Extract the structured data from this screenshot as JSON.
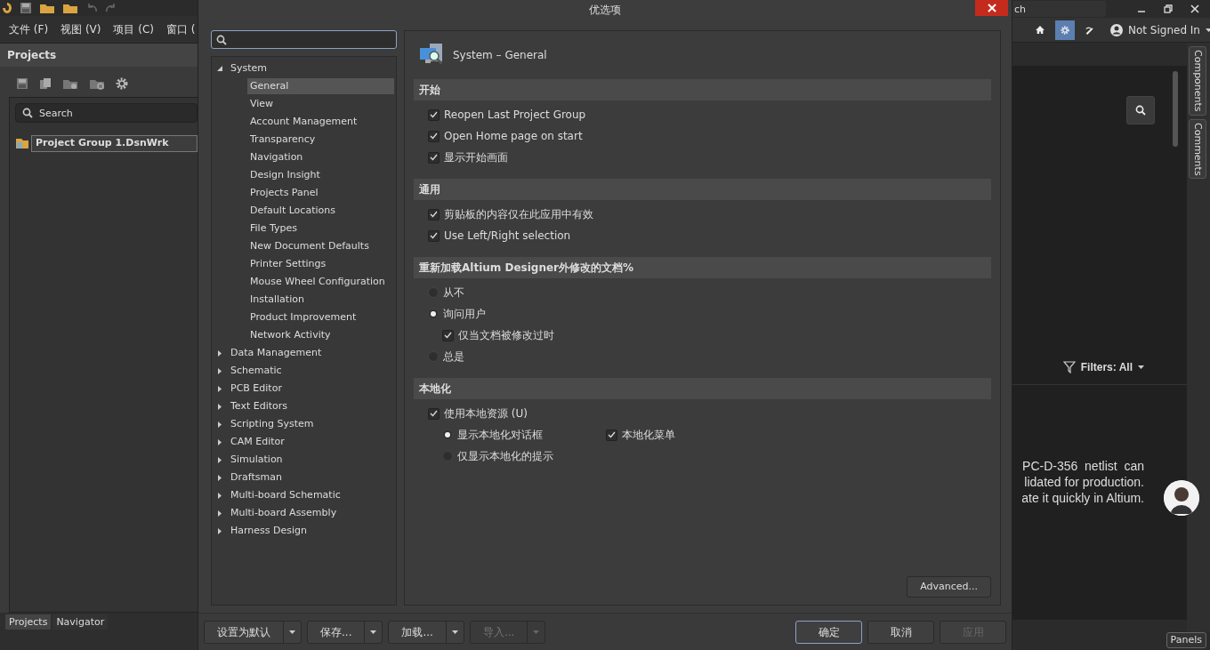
{
  "app": {
    "menu": [
      "文件 (F)",
      "视图 (V)",
      "项目 (C)",
      "窗口 ("
    ],
    "projects_panel": {
      "title": "Projects",
      "search": {
        "placeholder": "Search"
      },
      "items": [
        {
          "label": "Project Group 1.DsnWrk",
          "selected": true
        }
      ],
      "tabs": [
        {
          "label": "Projects",
          "selected": true
        },
        {
          "label": "Navigator",
          "selected": false
        }
      ]
    },
    "search_field": {
      "value": "ch"
    },
    "toolbar": [
      {
        "kind": "home",
        "selected": false
      },
      {
        "kind": "gear",
        "selected": true
      },
      {
        "kind": "pen",
        "selected": false
      }
    ],
    "account": "Not Signed In",
    "side_tabs": [
      "Components",
      "Comments"
    ],
    "filter": "Filters: All",
    "text_lines": [
      "PC-D-356  netlist  can",
      "lidated for production.",
      "ate it quickly in Altium."
    ],
    "panels_button": "Panels"
  },
  "dialog": {
    "title": "优选项",
    "tree": [
      {
        "label": "System",
        "expanded": true,
        "selected": false,
        "children": [
          {
            "label": "General",
            "selected": true
          },
          {
            "label": "View",
            "selected": false
          },
          {
            "label": "Account Management",
            "selected": false
          },
          {
            "label": "Transparency",
            "selected": false
          },
          {
            "label": "Navigation",
            "selected": false
          },
          {
            "label": "Design Insight",
            "selected": false
          },
          {
            "label": "Projects Panel",
            "selected": false
          },
          {
            "label": "Default Locations",
            "selected": false
          },
          {
            "label": "File Types",
            "selected": false
          },
          {
            "label": "New Document Defaults",
            "selected": false
          },
          {
            "label": "Printer Settings",
            "selected": false
          },
          {
            "label": "Mouse Wheel Configuration",
            "selected": false
          },
          {
            "label": "Installation",
            "selected": false
          },
          {
            "label": "Product Improvement",
            "selected": false
          },
          {
            "label": "Network Activity",
            "selected": false
          }
        ]
      },
      {
        "label": "Data Management",
        "expanded": false,
        "selected": false
      },
      {
        "label": "Schematic",
        "expanded": false,
        "selected": false
      },
      {
        "label": "PCB Editor",
        "expanded": false,
        "selected": false
      },
      {
        "label": "Text Editors",
        "expanded": false,
        "selected": false
      },
      {
        "label": "Scripting System",
        "expanded": false,
        "selected": false
      },
      {
        "label": "CAM Editor",
        "expanded": false,
        "selected": false
      },
      {
        "label": "Simulation",
        "expanded": false,
        "selected": false
      },
      {
        "label": "Draftsman",
        "expanded": false,
        "selected": false
      },
      {
        "label": "Multi-board Schematic",
        "expanded": false,
        "selected": false
      },
      {
        "label": "Multi-board Assembly",
        "expanded": false,
        "selected": false
      },
      {
        "label": "Harness Design",
        "expanded": false,
        "selected": false
      }
    ],
    "page_title": "System – General",
    "sections": [
      {
        "title": "开始",
        "options": [
          {
            "kind": "checkbox",
            "label": "Reopen Last Project Group",
            "checked": true
          },
          {
            "kind": "checkbox",
            "label": "Open Home page on start",
            "checked": true
          },
          {
            "kind": "checkbox",
            "label": "显示开始画面",
            "checked": true
          }
        ]
      },
      {
        "title": "通用",
        "options": [
          {
            "kind": "checkbox",
            "label": "剪贴板的内容仅在此应用中有效",
            "checked": true
          },
          {
            "kind": "checkbox",
            "label": "Use Left/Right selection",
            "checked": true
          }
        ]
      },
      {
        "title": "重新加载Altium Designer外修改的文档%",
        "options": [
          {
            "kind": "radio",
            "label": "从不",
            "selected": false
          },
          {
            "kind": "radio",
            "label": "询问用户",
            "selected": true,
            "children": [
              {
                "kind": "checkbox",
                "label": "仅当文档被修改过时",
                "checked": true
              }
            ]
          },
          {
            "kind": "radio",
            "label": "总是",
            "selected": false
          }
        ]
      },
      {
        "title": "本地化",
        "options": [
          {
            "kind": "checkbox",
            "label": "使用本地资源 (U)",
            "checked": true,
            "children": [
              {
                "kind": "radio",
                "label": "显示本地化对话框",
                "selected": true
              },
              {
                "kind": "radio",
                "label": "仅显示本地化的提示",
                "selected": false
              }
            ],
            "aside": [
              {
                "kind": "checkbox",
                "label": "本地化菜单",
                "checked": true
              }
            ]
          }
        ]
      }
    ],
    "advanced_button": "Advanced...",
    "left_buttons": [
      {
        "label": "设置为默认",
        "disabled": false
      },
      {
        "label": "保存...",
        "disabled": false
      },
      {
        "label": "加载...",
        "disabled": false
      },
      {
        "label": "导入...",
        "disabled": true
      }
    ],
    "right_buttons": [
      {
        "label": "确定",
        "disabled": false,
        "default": true
      },
      {
        "label": "取消",
        "disabled": false,
        "default": false
      },
      {
        "label": "应用",
        "disabled": true,
        "default": false
      }
    ]
  }
}
